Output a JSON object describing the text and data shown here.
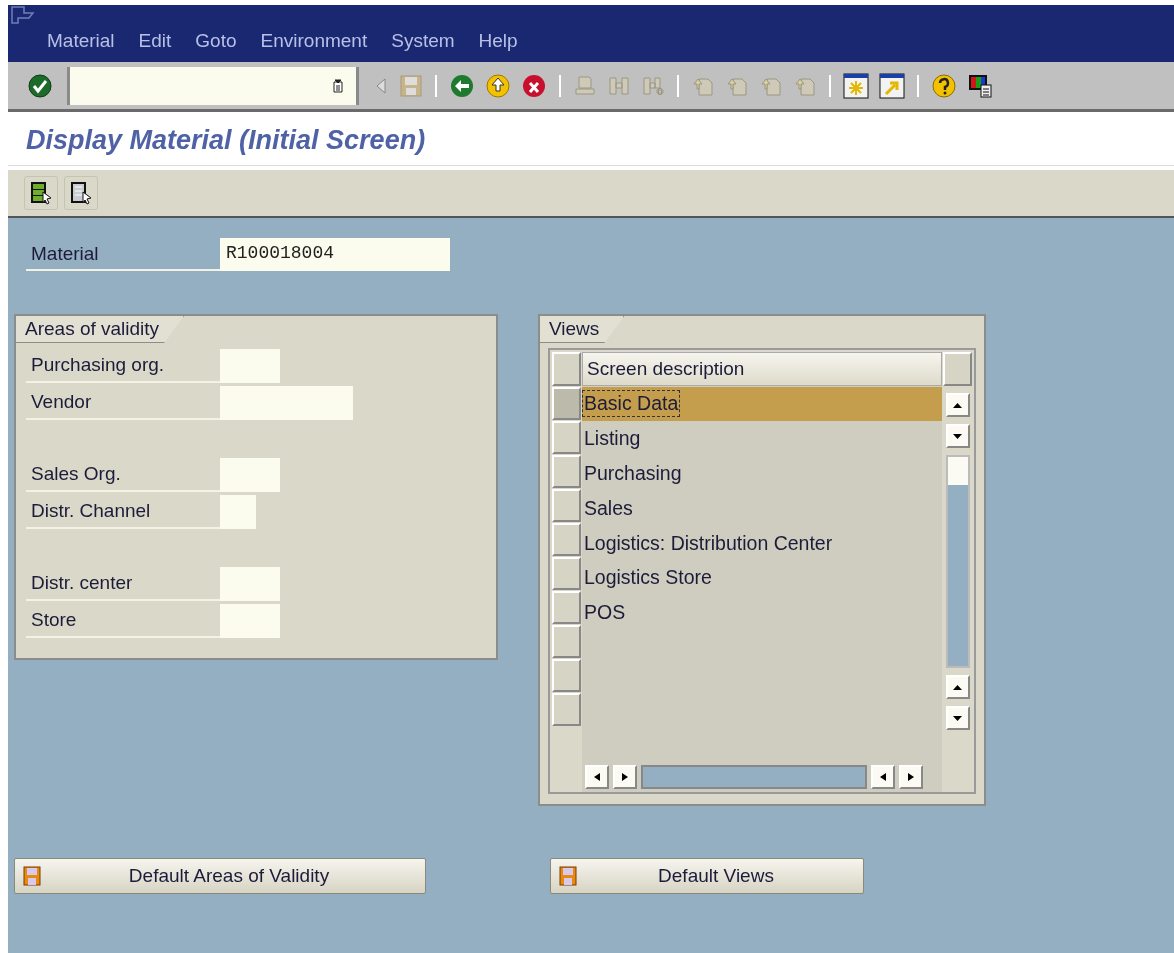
{
  "menu": [
    {
      "label": "Material"
    },
    {
      "label": "Edit"
    },
    {
      "label": "Goto"
    },
    {
      "label": "Environment"
    },
    {
      "label": "System"
    },
    {
      "label": "Help"
    }
  ],
  "title": "Display Material (Initial Screen)",
  "material": {
    "label": "Material",
    "value": "R100018004"
  },
  "areas": {
    "title": "Areas of validity",
    "groups": [
      {
        "fields": [
          {
            "label": "Purchasing org.",
            "kind": "medium"
          },
          {
            "label": "Vendor",
            "kind": "long"
          }
        ]
      },
      {
        "fields": [
          {
            "label": "Sales Org.",
            "kind": "medium"
          },
          {
            "label": "Distr. Channel",
            "kind": "short"
          }
        ]
      },
      {
        "fields": [
          {
            "label": "Distr. center",
            "kind": "medium"
          },
          {
            "label": "Store",
            "kind": "medium"
          }
        ]
      }
    ]
  },
  "views": {
    "title": "Views",
    "column": "Screen description",
    "rows": [
      {
        "label": "Basic Data",
        "selected": true
      },
      {
        "label": "Listing",
        "selected": false
      },
      {
        "label": "Purchasing",
        "selected": false
      },
      {
        "label": "Sales",
        "selected": false
      },
      {
        "label": "Logistics: Distribution Center",
        "selected": false
      },
      {
        "label": "Logistics Store",
        "selected": false
      },
      {
        "label": "POS",
        "selected": false
      }
    ]
  },
  "buttons": [
    {
      "label": "Default Areas of Validity"
    },
    {
      "label": "Default Views"
    }
  ]
}
